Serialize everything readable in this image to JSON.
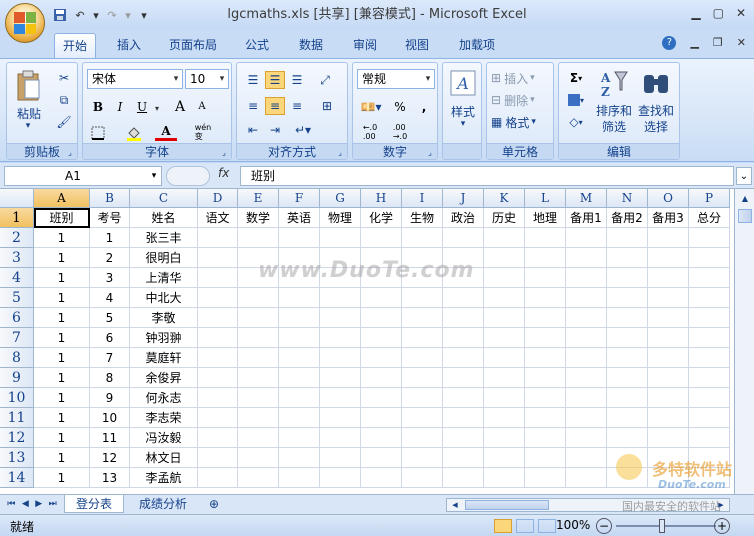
{
  "window": {
    "title": "lgcmaths.xls  [共享]  [兼容模式] - Microsoft Excel"
  },
  "qat": {
    "save": "save-icon",
    "undo": "↶",
    "redo": "↷"
  },
  "tabs": [
    "开始",
    "插入",
    "页面布局",
    "公式",
    "数据",
    "审阅",
    "视图",
    "加载项"
  ],
  "ribbon": {
    "clipboard": {
      "label": "剪贴板",
      "paste": "粘贴"
    },
    "font": {
      "label": "字体",
      "name": "宋体",
      "size": "10",
      "bold": "B",
      "italic": "I",
      "underline": "U",
      "grow": "A",
      "shrink": "A",
      "fontcolor": "A",
      "wen": "wén\n变"
    },
    "align": {
      "label": "对齐方式"
    },
    "number": {
      "label": "数字",
      "format": "常规",
      "percent": "%",
      "comma": ",",
      "inc": "←.0\n.00",
      "dec": ".00\n→.0"
    },
    "styles": {
      "label": "样式"
    },
    "cells": {
      "label": "单元格",
      "insert": "插入",
      "delete": "删除",
      "format": "格式"
    },
    "editing": {
      "label": "编辑",
      "sigma": "Σ",
      "sort": "排序和\n筛选",
      "find": "查找和\n选择"
    }
  },
  "formula": {
    "namebox": "A1",
    "fx": "fx",
    "content": "班别"
  },
  "columns": [
    "A",
    "B",
    "C",
    "D",
    "E",
    "F",
    "G",
    "H",
    "I",
    "J",
    "K",
    "L",
    "M",
    "N",
    "O",
    "P"
  ],
  "rows": [
    [
      "班别",
      "考号",
      "姓名",
      "语文",
      "数学",
      "英语",
      "物理",
      "化学",
      "生物",
      "政治",
      "历史",
      "地理",
      "备用1",
      "备用2",
      "备用3",
      "总分"
    ],
    [
      "1",
      "1",
      "张三丰"
    ],
    [
      "1",
      "2",
      "很明白"
    ],
    [
      "1",
      "3",
      "上清华"
    ],
    [
      "1",
      "4",
      "中北大"
    ],
    [
      "1",
      "5",
      "李敬"
    ],
    [
      "1",
      "6",
      "钟羽翀"
    ],
    [
      "1",
      "7",
      "莫庭轩"
    ],
    [
      "1",
      "8",
      "余俊昇"
    ],
    [
      "1",
      "9",
      "何永志"
    ],
    [
      "1",
      "10",
      "李志荣"
    ],
    [
      "1",
      "11",
      "冯汝毅"
    ],
    [
      "1",
      "12",
      "林文日"
    ],
    [
      "1",
      "13",
      "李孟航"
    ]
  ],
  "sheets": [
    "登分表",
    "成绩分析"
  ],
  "status": {
    "ready": "就绪",
    "zoom": "100%"
  },
  "watermark": {
    "main": "www.DuoTe.com",
    "brand": "多特软件站",
    "brand2": "DuoTe.com",
    "tagline": "国内最安全的软件站"
  },
  "colors": {
    "accent": "#15428b",
    "selection": "#f1c15f"
  }
}
